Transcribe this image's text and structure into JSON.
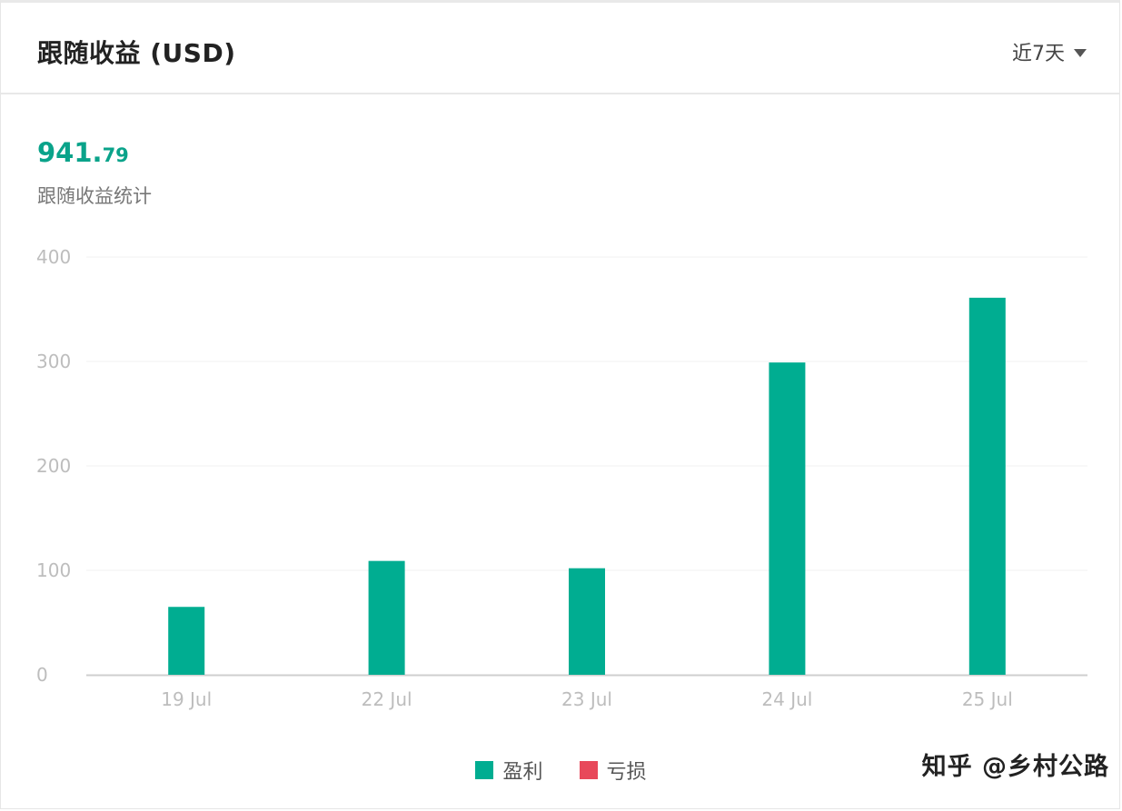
{
  "header": {
    "title": "跟随收益 (USD)",
    "range_label": "近7天"
  },
  "summary": {
    "total_int": "941.",
    "total_dec": "79",
    "label": "跟随收益统计"
  },
  "colors": {
    "profit": "#00ad91",
    "loss": "#e8485a",
    "accent": "#0aa38a"
  },
  "chart_data": {
    "type": "bar",
    "categories": [
      "19 Jul",
      "22 Jul",
      "23 Jul",
      "24 Jul",
      "25 Jul"
    ],
    "series": [
      {
        "name": "盈利",
        "values": [
          65,
          109,
          102,
          299,
          361
        ]
      },
      {
        "name": "亏损",
        "values": [
          0,
          0,
          0,
          0,
          0
        ]
      }
    ],
    "yticks": [
      "0",
      "100",
      "200",
      "300",
      "400"
    ],
    "ylim": [
      0,
      400
    ],
    "grid": true,
    "legend_position": "bottom"
  },
  "legend": {
    "profit_label": "盈利",
    "loss_label": "亏损"
  },
  "watermark": "知乎 @乡村公路"
}
